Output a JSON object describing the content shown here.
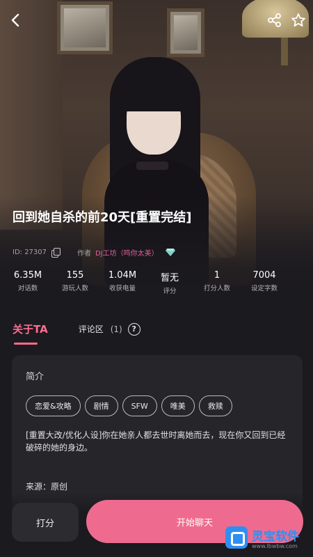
{
  "topbar": {
    "back_icon": "chevron-left-icon",
    "share_icon": "share-icon",
    "favorite_icon": "star-outline-icon"
  },
  "story": {
    "title": "回到她自杀的前20天[重置完结]",
    "id_text": "ID: 27307",
    "author_label": "作者",
    "author_name": "DJ工坊（鸣你太美）"
  },
  "stats": [
    {
      "value": "6.35M",
      "label": "对话数"
    },
    {
      "value": "155",
      "label": "游玩人数"
    },
    {
      "value": "1.04M",
      "label": "收获电量"
    },
    {
      "value": "暂无",
      "label": "评分"
    },
    {
      "value": "1",
      "label": "打分人数"
    },
    {
      "value": "7004",
      "label": "设定字数"
    }
  ],
  "tabs": {
    "about": "关于TA",
    "comments": "评论区",
    "comments_count": "(1)",
    "help": "?"
  },
  "card": {
    "heading": "简介",
    "tags": [
      "恋爱&攻略",
      "剧情",
      "SFW",
      "唯美",
      "救赎"
    ],
    "description": "[重置大改/优化人设]你在她亲人都去世时离她而去，现在你又回到已经破碎的她的身边。",
    "source": "来源：原创"
  },
  "bottom": {
    "rate_label": "打分",
    "start_chat_label": "开始聊天"
  },
  "watermark": {
    "name": "灵宝软件",
    "url": "www.lbwbw.com"
  },
  "colors": {
    "accent": "#ee6b8f",
    "tab_active": "#ff6d8f",
    "author": "#e0609a",
    "background": "#1b1a1f",
    "card": "#26252a"
  }
}
